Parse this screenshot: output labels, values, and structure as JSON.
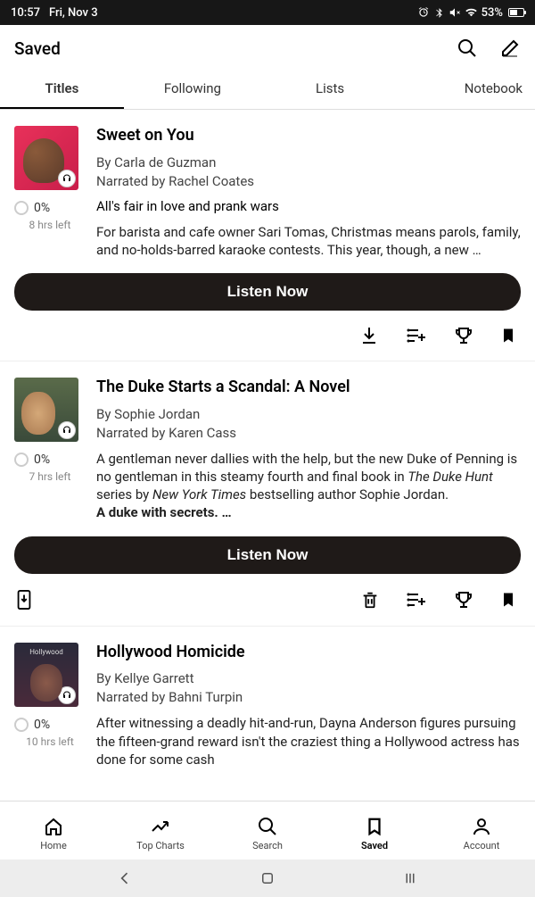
{
  "status": {
    "time": "10:57",
    "date": "Fri, Nov 3",
    "battery": "53%"
  },
  "header": {
    "title": "Saved"
  },
  "tabs": [
    "Titles",
    "Following",
    "Lists",
    "Notebook"
  ],
  "books": [
    {
      "title": "Sweet on You",
      "author": "By Carla de Guzman",
      "narrator": "Narrated by Rachel Coates",
      "progress": "0%",
      "time_left": "8 hrs left",
      "tagline": "All's fair in love and prank wars",
      "desc": "For barista and cafe owner Sari Tomas, Christmas means parols, family, and no-holds-barred karaoke contests. This year, though, a new …",
      "cta": "Listen Now"
    },
    {
      "title": "The Duke Starts a Scandal: A Novel",
      "author": "By Sophie Jordan",
      "narrator": "Narrated by Karen Cass",
      "progress": "0%",
      "time_left": "7 hrs left",
      "desc_html": "A gentleman never dallies with the help, but the new Duke of Penning is no gentleman in this steamy fourth and final book in <i>The Duke Hunt</i> series by <i>New York Times</i> bestselling author Sophie Jordan.<br><b>A duke with secrets. …</b>",
      "cta": "Listen Now"
    },
    {
      "title": "Hollywood Homicide",
      "author": "By Kellye Garrett",
      "narrator": "Narrated by Bahni Turpin",
      "progress": "0%",
      "time_left": "10 hrs left",
      "desc": "After witnessing a deadly hit-and-run, Dayna Anderson figures pursuing the fifteen-grand reward isn't the craziest thing a Hollywood actress has done for some cash"
    }
  ],
  "nav": {
    "home": "Home",
    "charts": "Top Charts",
    "search": "Search",
    "saved": "Saved",
    "account": "Account"
  }
}
